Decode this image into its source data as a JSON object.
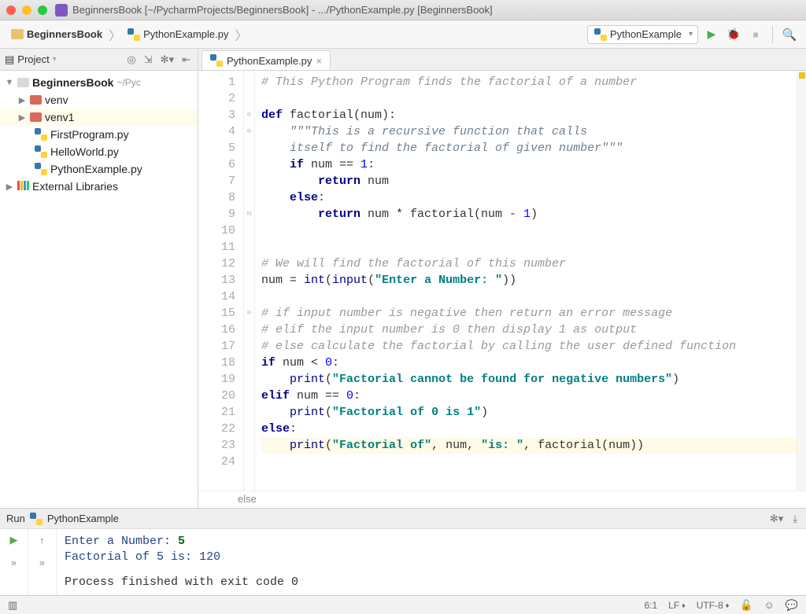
{
  "titlebar": {
    "title": "BeginnersBook [~/PycharmProjects/BeginnersBook] - .../PythonExample.py [BeginnersBook]"
  },
  "breadcrumb": {
    "project": "BeginnersBook",
    "file": "PythonExample.py"
  },
  "toolbar": {
    "run_config": "PythonExample"
  },
  "project_panel": {
    "title": "Project",
    "root": "BeginnersBook",
    "root_path": "~/Pyc",
    "items": [
      {
        "type": "dir",
        "label": "venv"
      },
      {
        "type": "dir",
        "label": "venv1"
      },
      {
        "type": "py",
        "label": "FirstProgram.py"
      },
      {
        "type": "py",
        "label": "HelloWorld.py"
      },
      {
        "type": "py",
        "label": "PythonExample.py"
      }
    ],
    "external": "External Libraries"
  },
  "editor": {
    "tab": "PythonExample.py",
    "breadcrumb_bottom": "else",
    "lines": [
      {
        "n": 1,
        "tokens": [
          {
            "t": "# This Python Program finds the factorial of a number",
            "c": "cc-comment"
          }
        ]
      },
      {
        "n": 2,
        "tokens": []
      },
      {
        "n": 3,
        "tokens": [
          {
            "t": "def ",
            "c": "cc-def"
          },
          {
            "t": "factorial",
            "c": "cc-fn"
          },
          {
            "t": "(num):",
            "c": ""
          }
        ]
      },
      {
        "n": 4,
        "tokens": [
          {
            "t": "    \"\"\"This is a recursive function that calls",
            "c": "cc-doc"
          }
        ]
      },
      {
        "n": 5,
        "tokens": [
          {
            "t": "    itself to find the factorial of given number\"\"\"",
            "c": "cc-doc"
          }
        ]
      },
      {
        "n": 6,
        "tokens": [
          {
            "t": "    ",
            "c": ""
          },
          {
            "t": "if ",
            "c": "cc-kw"
          },
          {
            "t": "num == ",
            "c": ""
          },
          {
            "t": "1",
            "c": "cc-num"
          },
          {
            "t": ":",
            "c": ""
          }
        ]
      },
      {
        "n": 7,
        "tokens": [
          {
            "t": "        ",
            "c": ""
          },
          {
            "t": "return ",
            "c": "cc-kw"
          },
          {
            "t": "num",
            "c": ""
          }
        ]
      },
      {
        "n": 8,
        "tokens": [
          {
            "t": "    ",
            "c": ""
          },
          {
            "t": "else",
            "c": "cc-kw"
          },
          {
            "t": ":",
            "c": ""
          }
        ]
      },
      {
        "n": 9,
        "tokens": [
          {
            "t": "        ",
            "c": ""
          },
          {
            "t": "return ",
            "c": "cc-kw"
          },
          {
            "t": "num * factorial(num - ",
            "c": ""
          },
          {
            "t": "1",
            "c": "cc-num"
          },
          {
            "t": ")",
            "c": ""
          }
        ]
      },
      {
        "n": 10,
        "tokens": []
      },
      {
        "n": 11,
        "tokens": []
      },
      {
        "n": 12,
        "tokens": [
          {
            "t": "# We will find the factorial of this number",
            "c": "cc-comment"
          }
        ]
      },
      {
        "n": 13,
        "tokens": [
          {
            "t": "num = ",
            "c": ""
          },
          {
            "t": "int",
            "c": "cc-builtin"
          },
          {
            "t": "(",
            "c": ""
          },
          {
            "t": "input",
            "c": "cc-builtin"
          },
          {
            "t": "(",
            "c": ""
          },
          {
            "t": "\"Enter a Number: \"",
            "c": "cc-str"
          },
          {
            "t": "))",
            "c": ""
          }
        ]
      },
      {
        "n": 14,
        "tokens": []
      },
      {
        "n": 15,
        "tokens": [
          {
            "t": "# if input number is negative then return an error message",
            "c": "cc-comment"
          }
        ]
      },
      {
        "n": 16,
        "tokens": [
          {
            "t": "# elif the input number is 0 then display 1 as output",
            "c": "cc-comment"
          }
        ]
      },
      {
        "n": 17,
        "tokens": [
          {
            "t": "# else calculate the factorial by calling the user defined function",
            "c": "cc-comment"
          }
        ]
      },
      {
        "n": 18,
        "tokens": [
          {
            "t": "if ",
            "c": "cc-kw"
          },
          {
            "t": "num < ",
            "c": ""
          },
          {
            "t": "0",
            "c": "cc-num"
          },
          {
            "t": ":",
            "c": ""
          }
        ]
      },
      {
        "n": 19,
        "tokens": [
          {
            "t": "    ",
            "c": ""
          },
          {
            "t": "print",
            "c": "cc-builtin"
          },
          {
            "t": "(",
            "c": ""
          },
          {
            "t": "\"Factorial cannot be found for negative numbers\"",
            "c": "cc-str"
          },
          {
            "t": ")",
            "c": ""
          }
        ]
      },
      {
        "n": 20,
        "tokens": [
          {
            "t": "elif ",
            "c": "cc-kw"
          },
          {
            "t": "num == ",
            "c": ""
          },
          {
            "t": "0",
            "c": "cc-num"
          },
          {
            "t": ":",
            "c": ""
          }
        ]
      },
      {
        "n": 21,
        "tokens": [
          {
            "t": "    ",
            "c": ""
          },
          {
            "t": "print",
            "c": "cc-builtin"
          },
          {
            "t": "(",
            "c": ""
          },
          {
            "t": "\"Factorial of 0 is 1\"",
            "c": "cc-str"
          },
          {
            "t": ")",
            "c": ""
          }
        ]
      },
      {
        "n": 22,
        "tokens": [
          {
            "t": "else",
            "c": "cc-kw"
          },
          {
            "t": ":",
            "c": ""
          }
        ]
      },
      {
        "n": 23,
        "hl": true,
        "tokens": [
          {
            "t": "    ",
            "c": ""
          },
          {
            "t": "print",
            "c": "cc-builtin"
          },
          {
            "t": "(",
            "c": ""
          },
          {
            "t": "\"Factorial of\"",
            "c": "cc-str"
          },
          {
            "t": ", num, ",
            "c": ""
          },
          {
            "t": "\"is: \"",
            "c": "cc-str"
          },
          {
            "t": ", factorial(num))",
            "c": ""
          }
        ]
      },
      {
        "n": 24,
        "tokens": []
      }
    ]
  },
  "run": {
    "label": "Run",
    "config": "PythonExample",
    "console": {
      "line1_prompt": "Enter a Number: ",
      "line1_input": "5",
      "line2_a": "Factorial of ",
      "line2_b": "5",
      "line2_c": " is:  ",
      "line2_d": "120",
      "line3": "Process finished with exit code 0"
    }
  },
  "status": {
    "pos": "6:1",
    "line_sep": "LF",
    "encoding": "UTF-8"
  }
}
